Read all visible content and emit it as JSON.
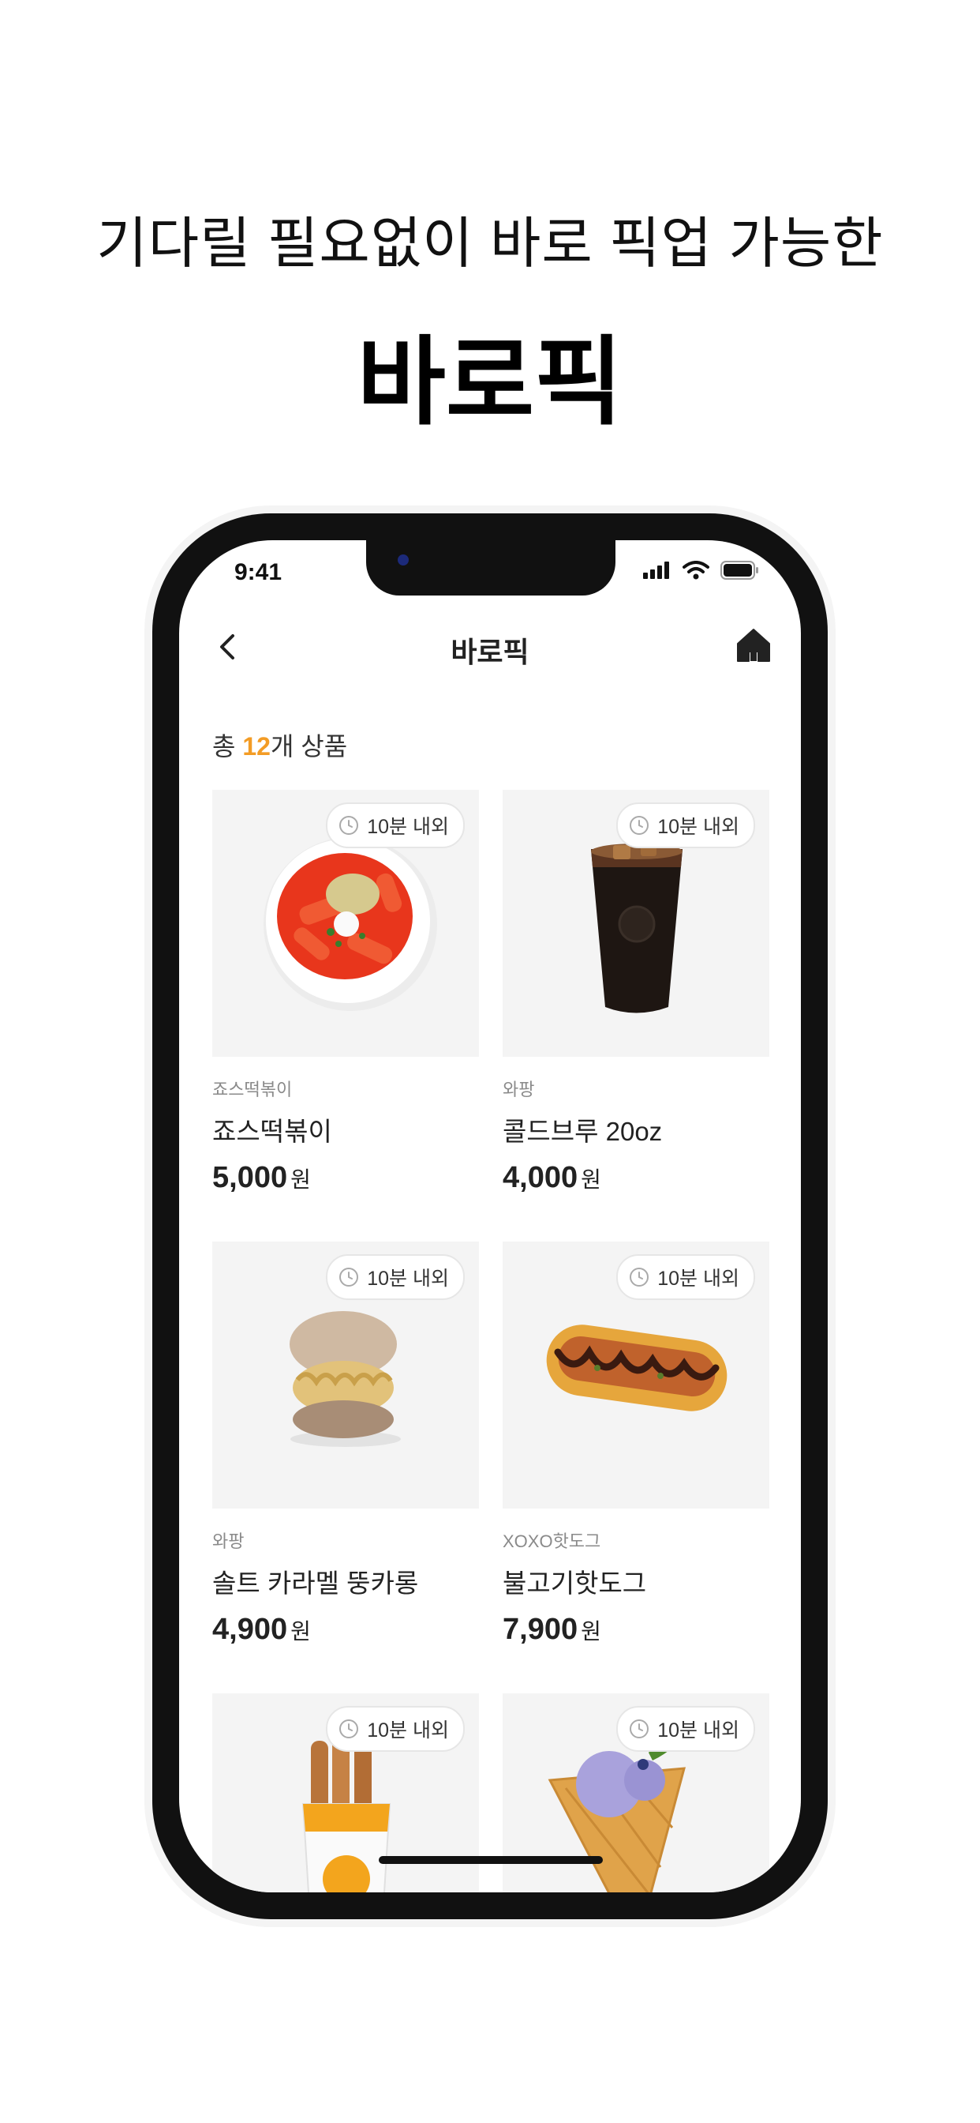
{
  "promo": {
    "subtitle": "기다릴 필요없이 바로 픽업 가능한",
    "title": "바로픽"
  },
  "status_bar": {
    "time": "9:41",
    "icons": [
      "signal-icon",
      "wifi-icon",
      "battery-icon"
    ]
  },
  "nav": {
    "title": "바로픽",
    "back_icon": "chevron-left-icon",
    "home_icon": "home-icon"
  },
  "summary": {
    "prefix": "총 ",
    "count": "12",
    "suffix": "개 상품"
  },
  "colors": {
    "accent": "#f39c25",
    "thumb_bg": "#f4f4f4",
    "frame": "#111111"
  },
  "products": [
    {
      "badge": "10분 내외",
      "store": "죠스떡볶이",
      "name": "죠스떡볶이",
      "price": "5,000",
      "unit": "원",
      "image": "tteokbokki"
    },
    {
      "badge": "10분 내외",
      "store": "와팡",
      "name": "콜드브루 20oz",
      "price": "4,000",
      "unit": "원",
      "image": "cold-brew"
    },
    {
      "badge": "10분 내외",
      "store": "와팡",
      "name": "솔트 카라멜 뚱카롱",
      "price": "4,900",
      "unit": "원",
      "image": "macaron"
    },
    {
      "badge": "10분 내외",
      "store": "XOXO핫도그",
      "name": "불고기핫도그",
      "price": "7,900",
      "unit": "원",
      "image": "hotdog"
    },
    {
      "badge": "10분 내외",
      "store": "",
      "name": "",
      "price": "",
      "unit": "",
      "image": "pretzel-sticks"
    },
    {
      "badge": "10분 내외",
      "store": "",
      "name": "",
      "price": "",
      "unit": "",
      "image": "ice-cream-cone"
    }
  ]
}
